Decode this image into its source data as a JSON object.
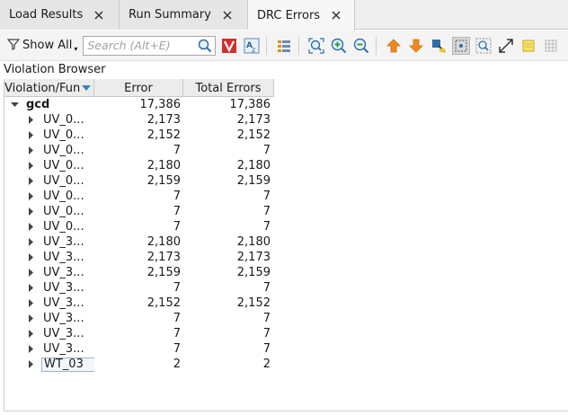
{
  "tabs": [
    {
      "label": "Load Results",
      "active": false
    },
    {
      "label": "Run Summary",
      "active": false
    },
    {
      "label": "DRC Errors",
      "active": true
    }
  ],
  "toolbar": {
    "filter_label": "Show All",
    "search_placeholder": "Search (Alt+E)",
    "icons": [
      "filter-icon",
      "search-icon",
      "violation-v-icon",
      "font-az-icon",
      "list-columns-icon",
      "zoom-fit-icon",
      "zoom-in-icon",
      "zoom-out-icon",
      "arrow-up-icon",
      "arrow-down-icon",
      "highlight-icon",
      "select-area-icon",
      "zoom-selection-icon",
      "fit-view-icon",
      "note-icon",
      "grid-icon"
    ]
  },
  "panel": {
    "title": "Violation Browser"
  },
  "table": {
    "columns": [
      "Violation/Fun",
      "Error",
      "Total Errors"
    ],
    "root": {
      "name": "gcd",
      "error": "17,386",
      "total": "17,386",
      "expanded": true
    },
    "children": [
      {
        "name": "UV_0...",
        "error": "2,173",
        "total": "2,173"
      },
      {
        "name": "UV_0...",
        "error": "2,152",
        "total": "2,152"
      },
      {
        "name": "UV_0...",
        "error": "7",
        "total": "7"
      },
      {
        "name": "UV_0...",
        "error": "2,180",
        "total": "2,180"
      },
      {
        "name": "UV_0...",
        "error": "2,159",
        "total": "2,159"
      },
      {
        "name": "UV_0...",
        "error": "7",
        "total": "7"
      },
      {
        "name": "UV_0...",
        "error": "7",
        "total": "7"
      },
      {
        "name": "UV_0...",
        "error": "7",
        "total": "7"
      },
      {
        "name": "UV_3...",
        "error": "2,180",
        "total": "2,180"
      },
      {
        "name": "UV_3...",
        "error": "2,173",
        "total": "2,173"
      },
      {
        "name": "UV_3...",
        "error": "2,159",
        "total": "2,159"
      },
      {
        "name": "UV_3...",
        "error": "7",
        "total": "7"
      },
      {
        "name": "UV_3...",
        "error": "2,152",
        "total": "2,152"
      },
      {
        "name": "UV_3...",
        "error": "7",
        "total": "7"
      },
      {
        "name": "UV_3...",
        "error": "7",
        "total": "7"
      },
      {
        "name": "UV_3...",
        "error": "7",
        "total": "7"
      },
      {
        "name": "WT_03",
        "error": "2",
        "total": "2",
        "selected": true
      }
    ]
  },
  "colors": {
    "accent_sort": "#3a7fc4",
    "orange_arrow": "#f08a1c",
    "red_v": "#d0312d"
  }
}
